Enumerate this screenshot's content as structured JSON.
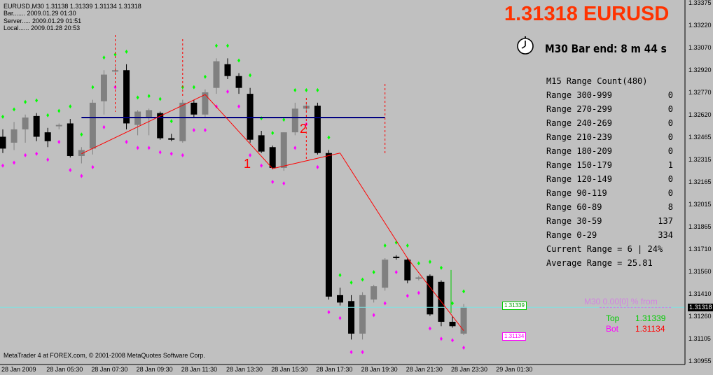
{
  "header": {
    "symbol_line": "EURUSD,M30  1.31138 1.31339 1.31134 1.31318",
    "bar_line": "Bar....... 2009.01.29 01:30",
    "server_line": "Server..... 2009.01.29 01:51",
    "local_line": "Local...... 2009.01.28 20:53"
  },
  "big_price": "1.31318 EURUSD",
  "bar_end": "M30 Bar end: 8 m 44 s",
  "range_table": {
    "title": "M15 Range Count(480)",
    "rows": [
      {
        "label": "Range 300-999",
        "value": "0"
      },
      {
        "label": "Range 270-299",
        "value": "0"
      },
      {
        "label": "Range 240-269",
        "value": "0"
      },
      {
        "label": "Range 210-239",
        "value": "0"
      },
      {
        "label": "Range 180-209",
        "value": "0"
      },
      {
        "label": "Range 150-179",
        "value": "1"
      },
      {
        "label": "Range 120-149",
        "value": "0"
      },
      {
        "label": "Range 90-119",
        "value": "0"
      },
      {
        "label": "Range 60-89",
        "value": "8"
      },
      {
        "label": "Range 30-59",
        "value": "137"
      },
      {
        "label": "Range 0-29",
        "value": "334"
      }
    ],
    "current": "Current Range = 6 | 24%",
    "average": "Average Range = 25.81"
  },
  "m30_label": "M30 0.00[0] % from",
  "top": {
    "label": "Top",
    "value": "1.31339",
    "color": "#00cc00"
  },
  "bot": {
    "label": "Bot",
    "value": "1.31134",
    "color": "#ff00ff"
  },
  "copyright": "MetaTrader 4 at FOREX.com, © 2001-2008 MetaQuotes Software Corp.",
  "price_tags": {
    "top": "1.31339",
    "bot": "1.31134",
    "current": "1.31318"
  },
  "wave_labels": [
    "1",
    "2"
  ],
  "y_axis": [
    "1.33375",
    "1.33220",
    "1.33070",
    "1.32920",
    "1.32770",
    "1.32620",
    "1.32465",
    "1.32315",
    "1.32165",
    "1.32015",
    "1.31865",
    "1.31710",
    "1.31560",
    "1.31410",
    "1.31260",
    "1.31105",
    "1.30955"
  ],
  "x_axis": [
    "28 Jan 2009",
    "28 Jan 05:30",
    "28 Jan 07:30",
    "28 Jan 09:30",
    "28 Jan 11:30",
    "28 Jan 13:30",
    "28 Jan 15:30",
    "28 Jan 17:30",
    "28 Jan 19:30",
    "28 Jan 21:30",
    "28 Jan 23:30",
    "29 Jan 01:30"
  ],
  "colors": {
    "background": "#c0c0c0",
    "bull": "#808080",
    "bear": "#000000",
    "fractal_up": "#00ff00",
    "fractal_down": "#ff00ff",
    "zigzag": "#ff0000",
    "level": "#000080",
    "accent": "#ff3300"
  },
  "chart_data": {
    "type": "candlestick",
    "symbol": "EURUSD",
    "timeframe": "M30",
    "ylim": [
      1.30955,
      1.33375
    ],
    "candles": [
      {
        "o": 1.3247,
        "h": 1.3252,
        "l": 1.3236,
        "c": 1.3239
      },
      {
        "o": 1.3243,
        "h": 1.3257,
        "l": 1.3238,
        "c": 1.3252
      },
      {
        "o": 1.3252,
        "h": 1.3262,
        "l": 1.3243,
        "c": 1.326
      },
      {
        "o": 1.3261,
        "h": 1.3263,
        "l": 1.3244,
        "c": 1.3247
      },
      {
        "o": 1.325,
        "h": 1.3253,
        "l": 1.324,
        "c": 1.3244
      },
      {
        "o": 1.3255,
        "h": 1.3256,
        "l": 1.3252,
        "c": 1.3255
      },
      {
        "o": 1.3256,
        "h": 1.3259,
        "l": 1.3233,
        "c": 1.3234
      },
      {
        "o": 1.3234,
        "h": 1.324,
        "l": 1.3229,
        "c": 1.3238
      },
      {
        "o": 1.3239,
        "h": 1.3272,
        "l": 1.3235,
        "c": 1.327
      },
      {
        "o": 1.3271,
        "h": 1.3292,
        "l": 1.3262,
        "c": 1.3289
      },
      {
        "o": 1.3291,
        "h": 1.3294,
        "l": 1.3289,
        "c": 1.3292
      },
      {
        "o": 1.3292,
        "h": 1.3296,
        "l": 1.3252,
        "c": 1.3256
      },
      {
        "o": 1.3255,
        "h": 1.3265,
        "l": 1.3248,
        "c": 1.3264
      },
      {
        "o": 1.326,
        "h": 1.3266,
        "l": 1.3248,
        "c": 1.3265
      },
      {
        "o": 1.3263,
        "h": 1.3264,
        "l": 1.3245,
        "c": 1.3246
      },
      {
        "o": 1.3246,
        "h": 1.3249,
        "l": 1.3244,
        "c": 1.3245
      },
      {
        "o": 1.3244,
        "h": 1.3272,
        "l": 1.3243,
        "c": 1.327
      },
      {
        "o": 1.327,
        "h": 1.3272,
        "l": 1.326,
        "c": 1.3262
      },
      {
        "o": 1.3262,
        "h": 1.3279,
        "l": 1.326,
        "c": 1.3277
      },
      {
        "o": 1.328,
        "h": 1.33,
        "l": 1.3276,
        "c": 1.3298
      },
      {
        "o": 1.3296,
        "h": 1.33,
        "l": 1.3286,
        "c": 1.3288
      },
      {
        "o": 1.3288,
        "h": 1.329,
        "l": 1.3276,
        "c": 1.328
      },
      {
        "o": 1.3276,
        "h": 1.328,
        "l": 1.3243,
        "c": 1.3245
      },
      {
        "o": 1.3248,
        "h": 1.3251,
        "l": 1.3236,
        "c": 1.3237
      },
      {
        "o": 1.324,
        "h": 1.3241,
        "l": 1.3225,
        "c": 1.3226
      },
      {
        "o": 1.3226,
        "h": 1.325,
        "l": 1.3224,
        "c": 1.325
      },
      {
        "o": 1.325,
        "h": 1.327,
        "l": 1.3248,
        "c": 1.3266
      },
      {
        "o": 1.3266,
        "h": 1.327,
        "l": 1.3264,
        "c": 1.3268
      },
      {
        "o": 1.3268,
        "h": 1.327,
        "l": 1.3235,
        "c": 1.3236
      },
      {
        "o": 1.3236,
        "h": 1.3238,
        "l": 1.3137,
        "c": 1.3139
      },
      {
        "o": 1.314,
        "h": 1.3145,
        "l": 1.3133,
        "c": 1.3135
      },
      {
        "o": 1.3136,
        "h": 1.314,
        "l": 1.311,
        "c": 1.3114
      },
      {
        "o": 1.3114,
        "h": 1.3142,
        "l": 1.311,
        "c": 1.314
      },
      {
        "o": 1.3137,
        "h": 1.3147,
        "l": 1.3135,
        "c": 1.3146
      },
      {
        "o": 1.3145,
        "h": 1.3165,
        "l": 1.3143,
        "c": 1.3164
      },
      {
        "o": 1.3166,
        "h": 1.3167,
        "l": 1.3164,
        "c": 1.3165
      },
      {
        "o": 1.3164,
        "h": 1.3165,
        "l": 1.3148,
        "c": 1.315
      },
      {
        "o": 1.3151,
        "h": 1.3153,
        "l": 1.315,
        "c": 1.3152
      },
      {
        "o": 1.3153,
        "h": 1.3154,
        "l": 1.3126,
        "c": 1.3127
      },
      {
        "o": 1.3149,
        "h": 1.315,
        "l": 1.3119,
        "c": 1.3122
      },
      {
        "o": 1.3122,
        "h": 1.3126,
        "l": 1.3118,
        "c": 1.3119
      },
      {
        "o": 1.3114,
        "h": 1.3134,
        "l": 1.3113,
        "c": 1.3132
      }
    ],
    "level": 1.326
  }
}
